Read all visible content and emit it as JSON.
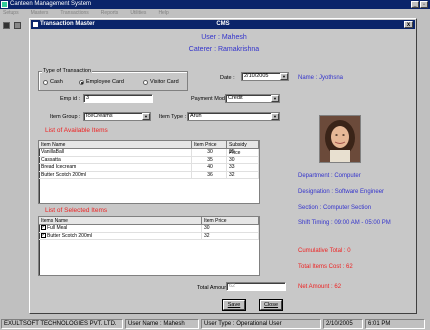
{
  "app": {
    "title": "Canteen Management System",
    "menu": [
      "Setups",
      "Masters",
      "Transactions",
      "Reports",
      "Utilities",
      "Help"
    ],
    "win_min": "_",
    "win_max": "▫",
    "win_close": "x"
  },
  "dialog": {
    "window_title": "Transaction Master",
    "center_title": "CMS",
    "close": "x",
    "user_line": "User : Mahesh",
    "caterer_line": "Caterer : Ramakrishna"
  },
  "type_of_transaction": {
    "group_label": "Type of Transaction",
    "options": [
      {
        "label": "Cash",
        "selected": false
      },
      {
        "label": "Employee Card",
        "selected": true
      },
      {
        "label": "Visitor Card",
        "selected": false
      }
    ]
  },
  "form": {
    "date_label": "Date :",
    "date_value": "2/10/2005",
    "emp_id_label": "Emp id :",
    "emp_id_value": "3",
    "payment_mode_label": "Payment Mode :",
    "payment_mode_value": "Credit",
    "item_group_label": "Item Group :",
    "item_group_value": "IceCreams",
    "item_type_label": "Item Type :",
    "item_type_value": "Arun"
  },
  "available": {
    "title": "List of Available  Items",
    "columns": [
      "Item Name",
      "Item Price",
      "Subsidy Price"
    ],
    "rows": [
      [
        "VanillaBall",
        "30",
        "25"
      ],
      [
        "Cassatta",
        "35",
        "30"
      ],
      [
        "Bread Icecream",
        "40",
        "33"
      ],
      [
        "Butter Scotch 200ml",
        "36",
        "32"
      ]
    ]
  },
  "selected": {
    "title": "List of Selected Items",
    "columns": [
      "Items Name",
      "Item Price"
    ],
    "rows": [
      {
        "name": "Full Meal",
        "price": "30",
        "checked": true
      },
      {
        "name": "Butter Scotch 200ml",
        "price": "32",
        "checked": true
      }
    ]
  },
  "totals": {
    "total_amount_label": "Total Amount :",
    "total_amount_value": "62"
  },
  "buttons": {
    "save": "Save",
    "close": "Close"
  },
  "employee": {
    "name_line": "Name : Jyothsna",
    "department": "Department : Computer",
    "designation": "Designation : Software Engineer",
    "section": "Section : Computer Section",
    "shift": "Shift Timing : 09:00 AM - 05:00 PM",
    "cumulative": "Cumulative Total : 0",
    "total_items_cost": "Total Items Cost : 62",
    "net_amount": "Net Amount : 62"
  },
  "statusbar": {
    "company": "EXULTSOFT TECHNOLOGIES PVT. LTD.",
    "user": "User Name :  Mahesh",
    "user_type": "User Type :  Operational User",
    "date": "2/10/2005",
    "time": "6:01 PM"
  },
  "colors": {
    "title_bar": "#0a246a",
    "info_blue": "#3333cc",
    "accent_red": "#ee2222"
  }
}
